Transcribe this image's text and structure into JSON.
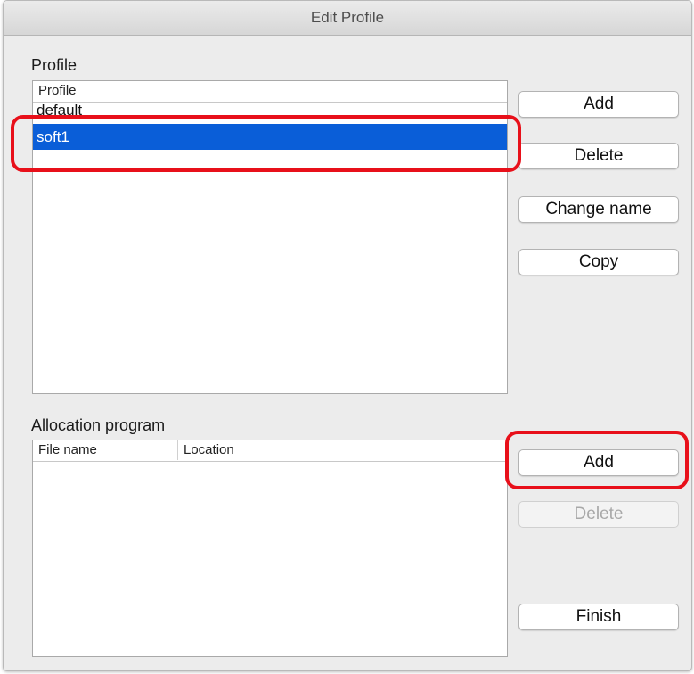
{
  "window": {
    "title": "Edit Profile"
  },
  "profile": {
    "section_label": "Profile",
    "column_header": "Profile",
    "items": [
      {
        "label": "default",
        "selected": false
      },
      {
        "label": "soft1",
        "selected": true
      }
    ],
    "buttons": {
      "add": "Add",
      "delete": "Delete",
      "change_name": "Change name",
      "copy": "Copy"
    }
  },
  "allocation": {
    "section_label": "Allocation program",
    "columns": {
      "file_name": "File name",
      "location": "Location"
    },
    "items": [],
    "buttons": {
      "add": "Add",
      "delete": "Delete",
      "delete_enabled": false
    }
  },
  "footer": {
    "finish": "Finish"
  },
  "colors": {
    "selection": "#0a5ed8",
    "annotation": "#e8101a"
  }
}
